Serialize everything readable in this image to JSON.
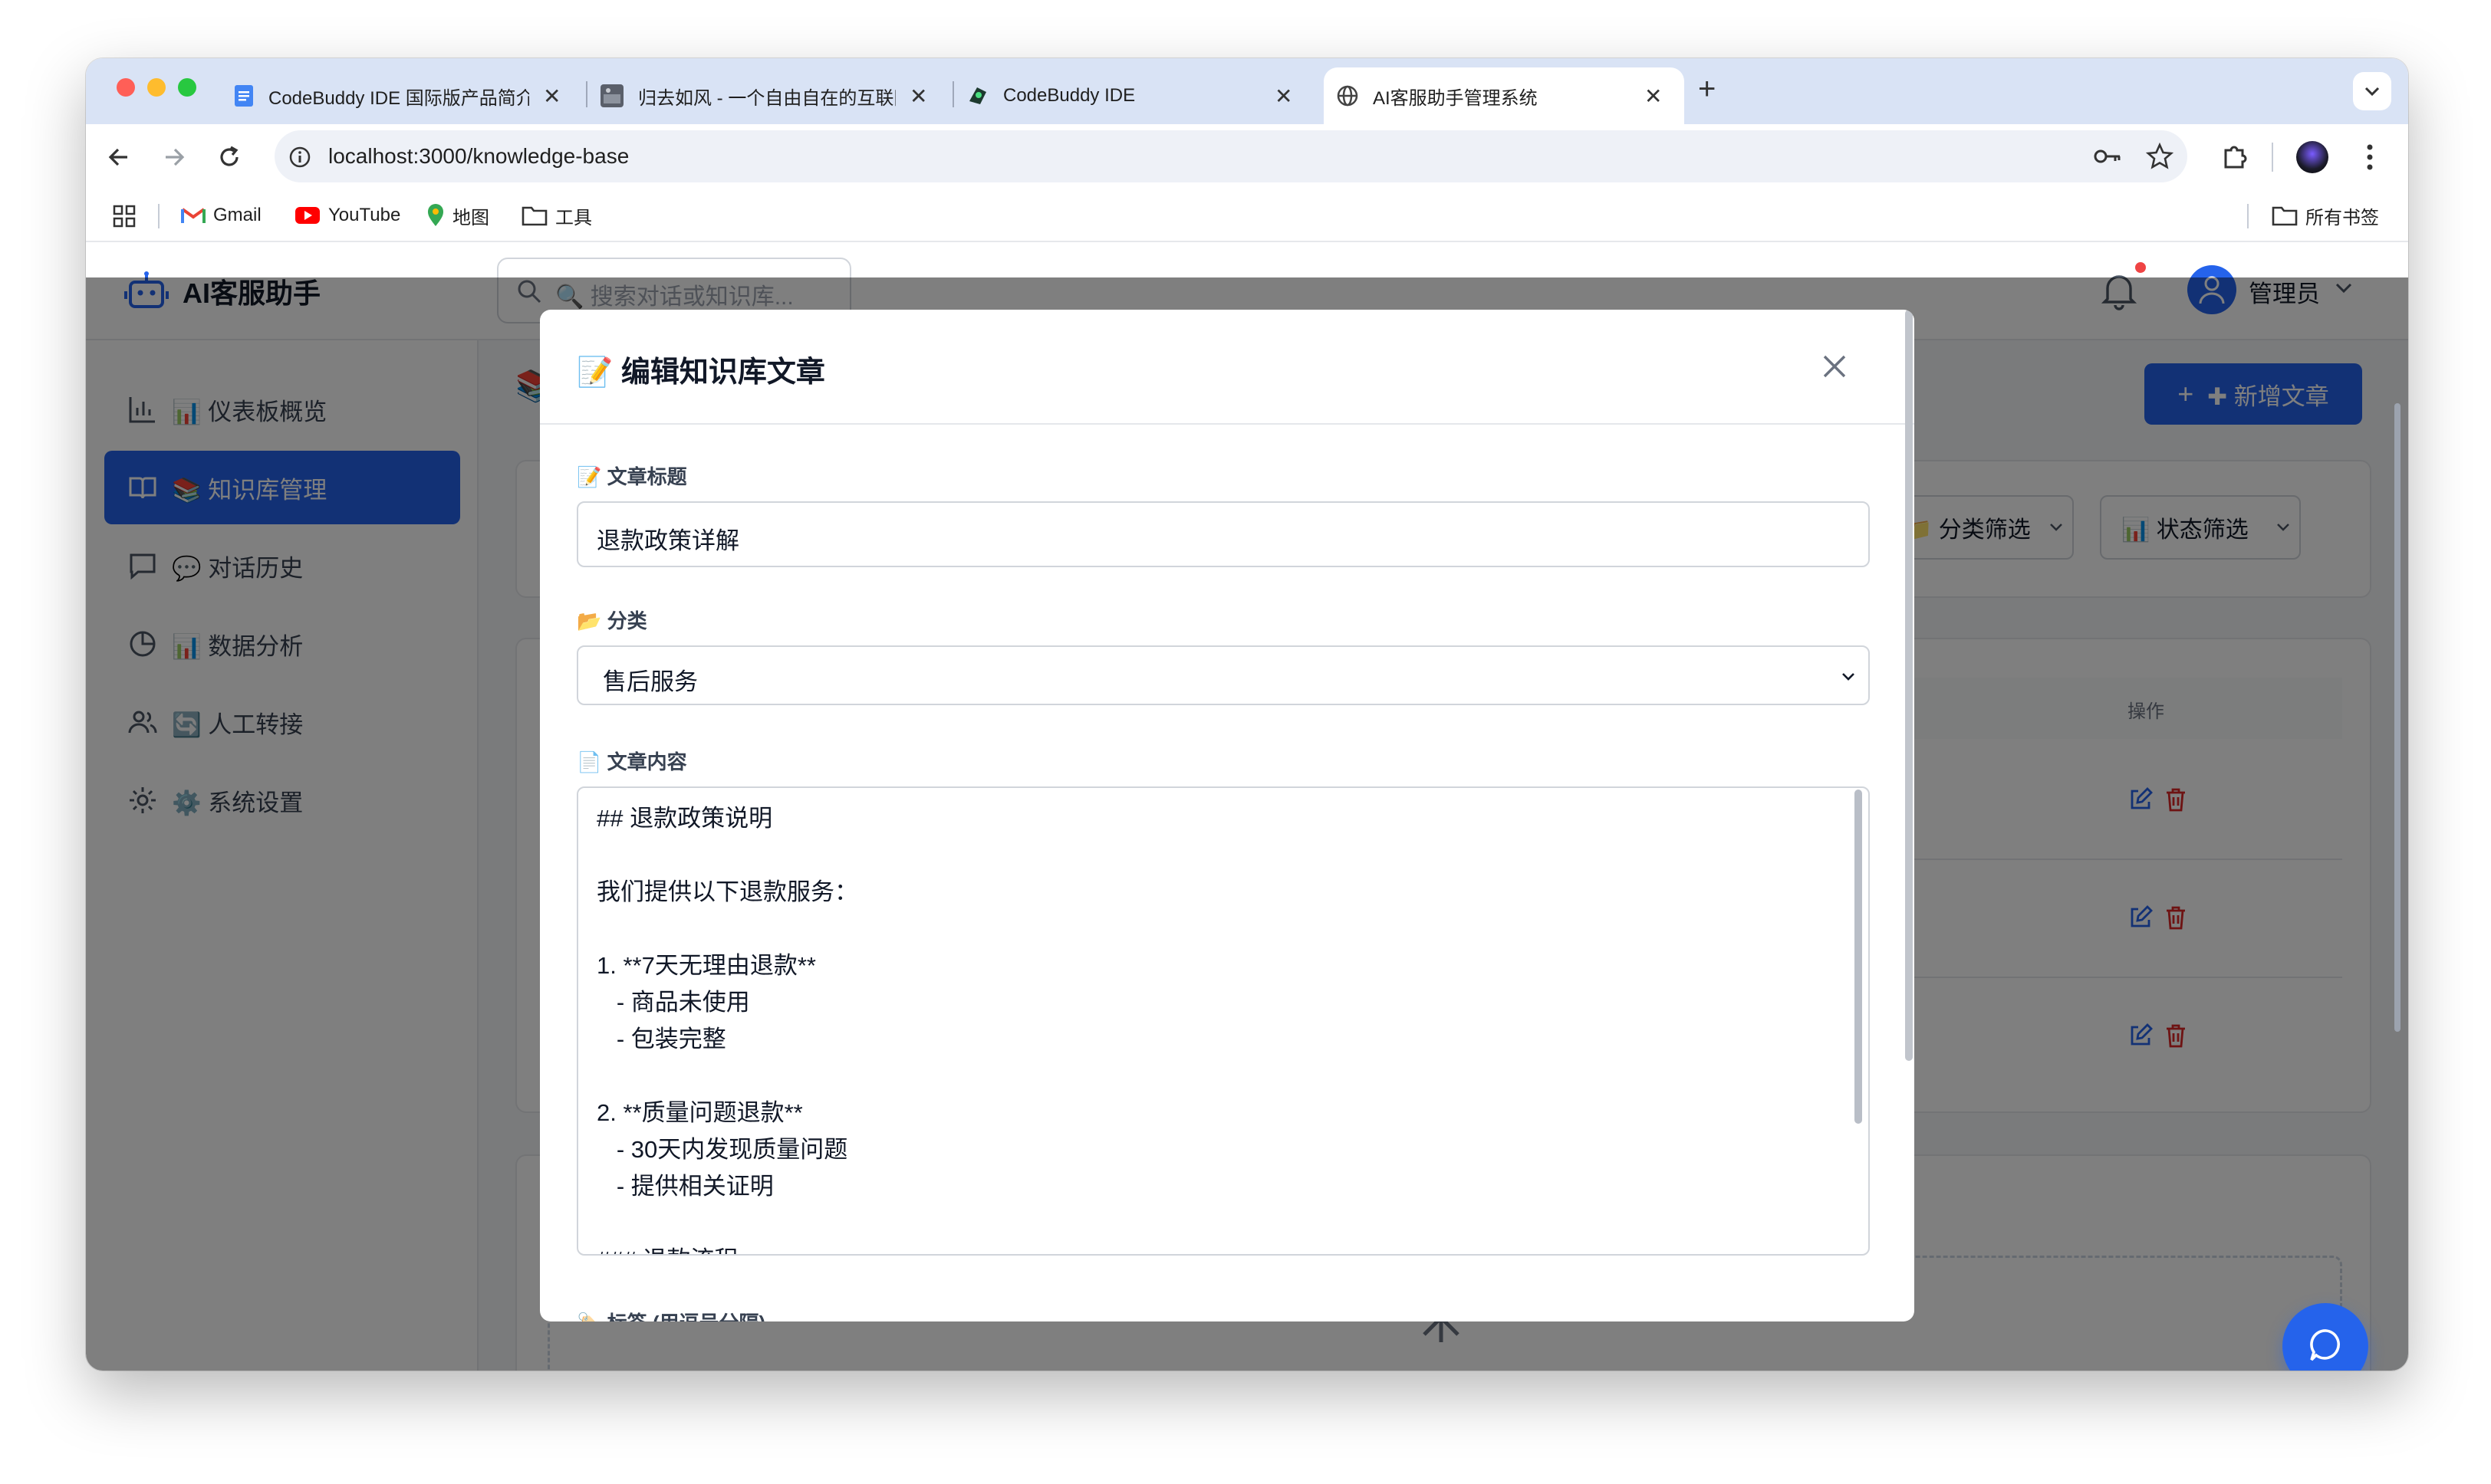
{
  "browser": {
    "tabs": [
      {
        "title": "CodeBuddy IDE 国际版产品简介",
        "icon": "google-docs-icon"
      },
      {
        "title": "归去如风 - 一个自由自在的互联网",
        "icon": "site-thumbnail-icon"
      },
      {
        "title": "CodeBuddy IDE",
        "icon": "codebuddy-icon"
      },
      {
        "title": "AI客服助手管理系统",
        "icon": "globe-icon",
        "active": true
      }
    ],
    "url": "localhost:3000/knowledge-base",
    "bookmarks": [
      "Gmail",
      "YouTube",
      "地图",
      "工具"
    ],
    "all_bookmarks": "所有书签"
  },
  "app": {
    "brand": "AI客服助手",
    "search_placeholder": "🔍 搜索对话或知识库...",
    "user_name": "管理员",
    "nav": [
      {
        "label": "📊 仪表板概览",
        "icon": "bar-chart-icon"
      },
      {
        "label": "📚 知识库管理",
        "icon": "book-icon",
        "active": true
      },
      {
        "label": "💬 对话历史",
        "icon": "message-icon"
      },
      {
        "label": "📊 数据分析",
        "icon": "pie-chart-icon"
      },
      {
        "label": "🔄 人工转接",
        "icon": "users-icon"
      },
      {
        "label": "⚙️ 系统设置",
        "icon": "gear-icon"
      }
    ],
    "new_article_button": "✚ 新增文章",
    "filter_category": "📁 分类筛选",
    "filter_status": "📊 状态筛选",
    "table_actions_header": "操作",
    "colors": {
      "primary": "#2563eb",
      "danger": "#dc2626"
    }
  },
  "modal": {
    "title": "📝 编辑知识库文章",
    "title_label": "📝 文章标题",
    "title_value": "退款政策详解",
    "category_label": "📂 分类",
    "category_value": "售后服务",
    "content_label": "📄 文章内容",
    "content_lines": [
      "## 退款政策说明",
      "",
      "我们提供以下退款服务：",
      "",
      "1. **7天无理由退款**",
      "   - 商品未使用",
      "   - 包装完整",
      "",
      "2. **质量问题退款**",
      "   - 30天内发现质量问题",
      "   - 提供相关证明",
      "",
      "### 退款流程"
    ],
    "tags_label": "🏷️ 标签 (用逗号分隔)"
  }
}
